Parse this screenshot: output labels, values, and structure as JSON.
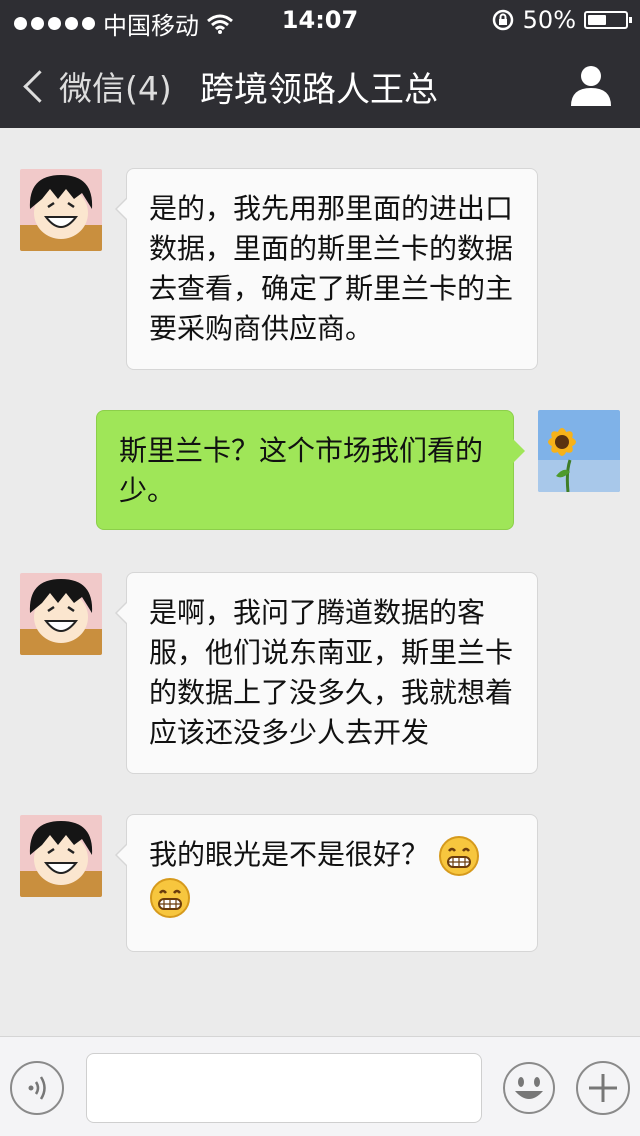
{
  "status_bar": {
    "carrier": "中国移动",
    "time": "14:07",
    "battery": "50%",
    "battery_level": 0.5,
    "icons": [
      "signal-dots-icon",
      "wifi-icon",
      "rotation-lock-icon",
      "battery-icon"
    ]
  },
  "nav": {
    "back_label": "微信(4)",
    "title": "跨境领路人王总",
    "right_icon": "person-icon"
  },
  "messages": [
    {
      "side": "left",
      "sender": "other",
      "text": "是的，我先用那里面的进出口数据，里面的斯里兰卡的数据去查看，确定了斯里兰卡的主要采购商供应商。"
    },
    {
      "side": "right",
      "sender": "me",
      "text": "斯里兰卡？这个市场我们看的少。"
    },
    {
      "side": "left",
      "sender": "other",
      "text": "是啊，我问了腾道数据的客服，他们说东南亚，斯里兰卡的数据上了没多久，我就想着应该还没多少人去开发"
    },
    {
      "side": "left",
      "sender": "other",
      "text": "我的眼光是不是很好？",
      "emojis": [
        "grin-emoji",
        "grin-emoji"
      ]
    }
  ],
  "input_bar": {
    "voice_icon": "voice-icon",
    "input_value": "",
    "emoji_icon": "smiley-icon",
    "plus_icon": "plus-icon"
  },
  "colors": {
    "nav_bg": "#2e2e33",
    "chat_bg": "#ebebeb",
    "my_bubble": "#9fe658",
    "other_bubble": "#fafafa"
  }
}
